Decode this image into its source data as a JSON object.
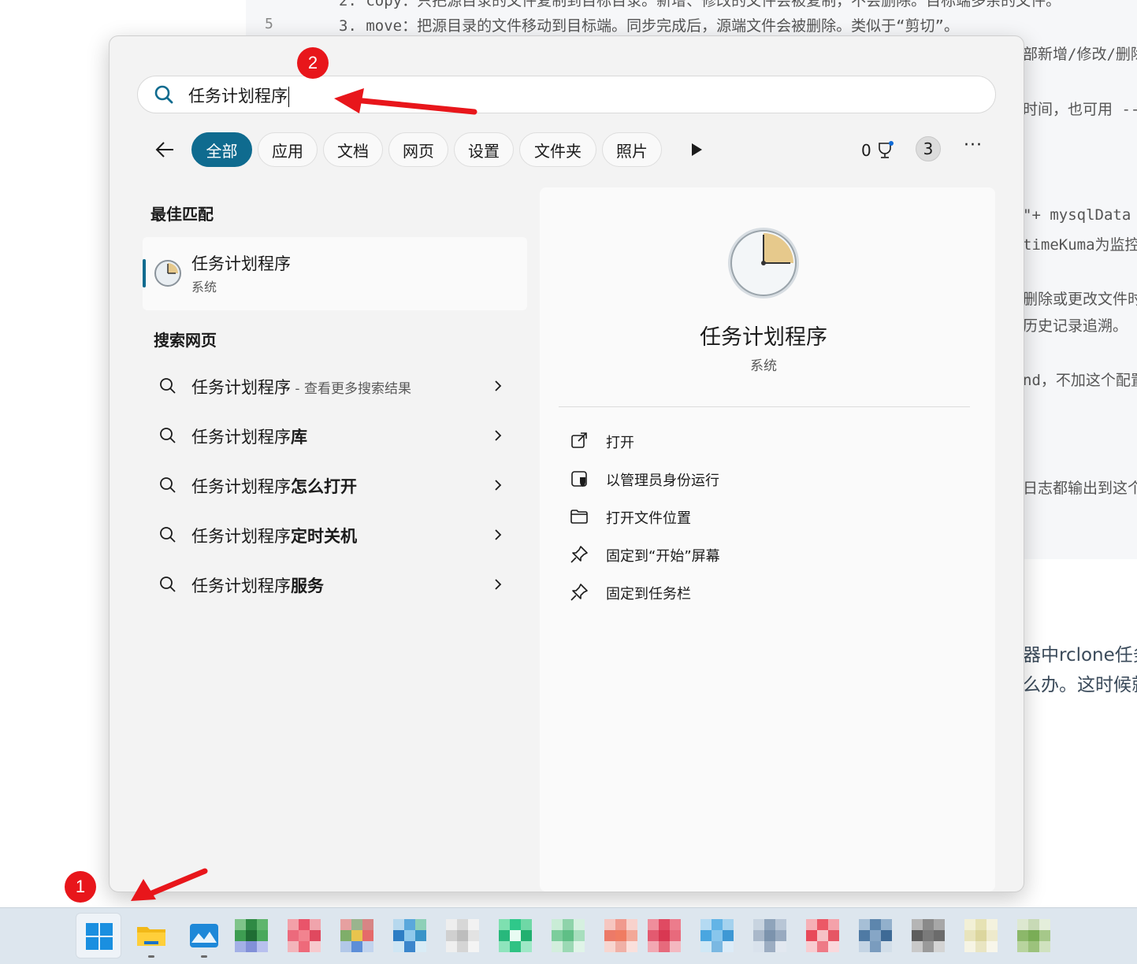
{
  "background": {
    "top_line": "2. copy：只把源目录的文件复制到目标目录。新增、修改的文件会被复制，不会删除。目标端多余的文件。",
    "line5_num": "5",
    "line5_text": "3. move：把源目录的文件移动到目标端。同步完成后，源端文件会被删除。类似于“剪切”。",
    "right_snippets": [
      "部新增/修改/删除",
      "时间，也可用 --",
      "\"+ mysqlData",
      "timeKuma为监控",
      "删除或更改文件时",
      "历史记录追溯。",
      "nd，不加这个配置",
      "日志都输出到这个"
    ],
    "article_snippets": [
      "器中rclone任务",
      "么办。这时候就"
    ]
  },
  "search": {
    "query": "任务计划程序"
  },
  "filters": {
    "chips": [
      "全部",
      "应用",
      "文档",
      "网页",
      "设置",
      "文件夹",
      "照片"
    ],
    "active_index": 0,
    "points": "0",
    "badge_count": "3",
    "more": "···"
  },
  "best_match": {
    "section_title": "最佳匹配",
    "name": "任务计划程序",
    "type": "系统"
  },
  "web_search": {
    "section_title": "搜索网页",
    "items": [
      {
        "prefix": "任务计划程序",
        "bold": "",
        "hint": " - 查看更多搜索结果"
      },
      {
        "prefix": "任务计划程序",
        "bold": "库",
        "hint": ""
      },
      {
        "prefix": "任务计划程序",
        "bold": "怎么打开",
        "hint": ""
      },
      {
        "prefix": "任务计划程序",
        "bold": "定时关机",
        "hint": ""
      },
      {
        "prefix": "任务计划程序",
        "bold": "服务",
        "hint": ""
      }
    ]
  },
  "detail": {
    "title": "任务计划程序",
    "subtitle": "系统",
    "actions": [
      {
        "label": "打开",
        "icon": "open-external-icon"
      },
      {
        "label": "以管理员身份运行",
        "icon": "shield-admin-icon"
      },
      {
        "label": "打开文件位置",
        "icon": "folder-icon"
      },
      {
        "label": "固定到“开始”屏幕",
        "icon": "pin-icon"
      },
      {
        "label": "固定到任务栏",
        "icon": "pin-icon"
      }
    ]
  },
  "annotations": {
    "marker1": "1",
    "marker2": "2",
    "color": "#e8161b"
  },
  "colors": {
    "accent": "#0f6b8f"
  }
}
